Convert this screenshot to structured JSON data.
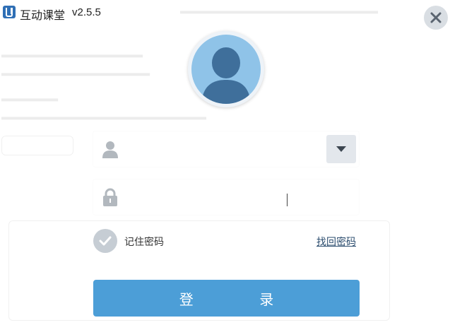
{
  "window": {
    "app_name": "互动课堂",
    "version": "v2.5.5"
  },
  "controls": {
    "close_icon": "close-icon"
  },
  "avatar": {
    "icon": "user-avatar-icon"
  },
  "username": {
    "icon": "user-icon",
    "value": "",
    "dropdown_icon": "chevron-down-icon"
  },
  "password": {
    "icon": "lock-icon",
    "value": ""
  },
  "remember": {
    "icon": "check-icon",
    "label": "记住密码",
    "checked": true
  },
  "forgot_link": "找回密码",
  "login_button": "登 录",
  "colors": {
    "accent": "#4c9ed7",
    "avatar_bg": "#8fc3e8",
    "background": "#ffffff",
    "close_bg": "#d9dee3",
    "link": "#2b4c6e"
  }
}
